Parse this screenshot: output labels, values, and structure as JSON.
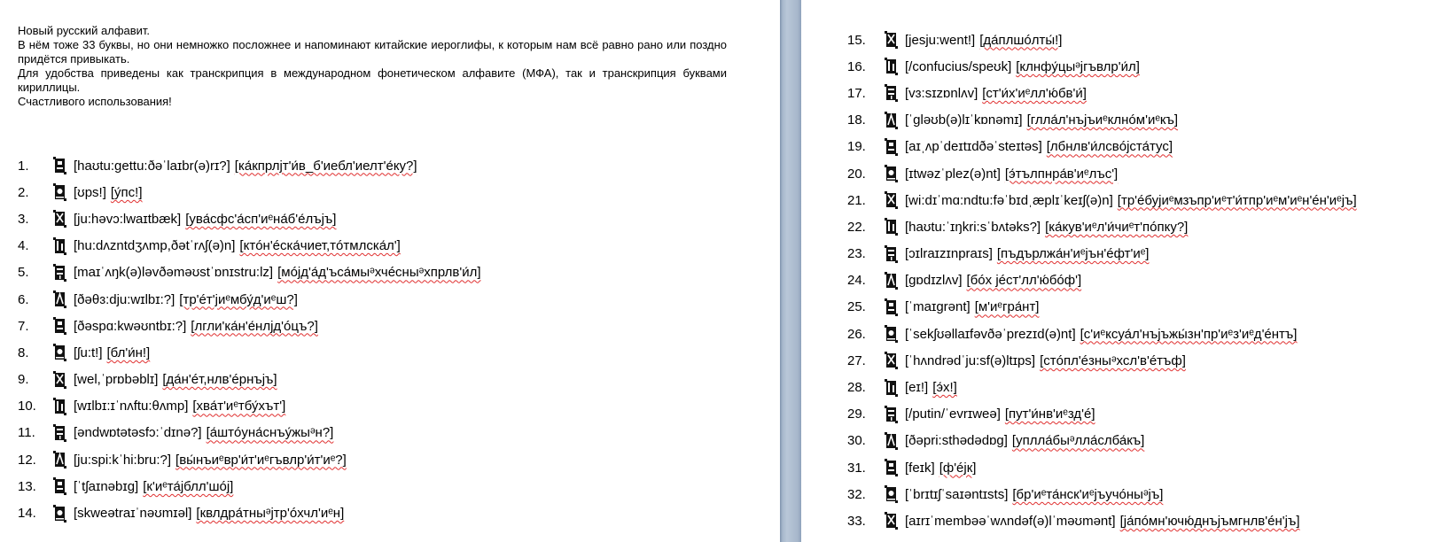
{
  "intro": {
    "title": "Новый русский алфавит.",
    "line1": "В нём тоже 33 буквы, но они немножко посложнее и напоминают китайские иероглифы, к которым нам всё равно рано или поздно придётся привыкать.",
    "line2": "Для удобства приведены как транскрипция в международном фонетическом алфавите (МФА), так и транскрипция буквами кириллицы.",
    "line3": "Счастливого использования!"
  },
  "letters": [
    {
      "n": "1.",
      "ipa": "[haʊtu:gettu:ðəˈlaɪbr(ə)rɪ?]",
      "cyr": "[ка́кпрлjт'и́в_б'иебл'иелт'е́ку?]"
    },
    {
      "n": "2.",
      "ipa": "[ʊps!]",
      "cyr": "[у́пс!]"
    },
    {
      "n": "3.",
      "ipa": "[ju:həvɔ:lwaɪtbæk]",
      "cyr": "[ува́сфс'а́сп'иᵉна́б'е́лъjъ]"
    },
    {
      "n": "4.",
      "ipa": "[hu:dʌzntdʒʌmp,ðətˈrʌʃ(ə)n]",
      "cyr": "[ктóн'éска́чиет,тóтмлска́л']"
    },
    {
      "n": "5.",
      "ipa": "[maɪˈʌŋk(ə)ləvðəməʊstˈɒnɪstru:lz]",
      "cyr": "[мójд'а́д'ъса́мыᵊхчéсныᵊхпрлв'и́л]"
    },
    {
      "n": "6.",
      "ipa": "[ðəθɜ:dju:wɪlbɪ:?]",
      "cyr": "[тр'éт'jиᵉмбу́д'иᵉш?]"
    },
    {
      "n": "7.",
      "ipa": "[ðəspɑ:kwəʊntbɪ:?]",
      "cyr": "[лгли'ка́н'е́нлjд'óцъ?]"
    },
    {
      "n": "8.",
      "ipa": "[ʃu:t!]",
      "cyr": "[бл'и́н!]"
    },
    {
      "n": "9.",
      "ipa": "[wel,ˈprɒbəblɪ]",
      "cyr": "[да́н'éт,нлв'éрнъjъ]"
    },
    {
      "n": "10.",
      "ipa": "[wɪlbɪ:ɪˈnʌftu:θʌmp]",
      "cyr": "[хва́т'иᵉтбу́хът']"
    },
    {
      "n": "11.",
      "ipa": "[əndwɒtətəsfɔ:ˈdɪnə?]",
      "cyr": "[а́штóуна́снъу́жыᵊн?]"
    },
    {
      "n": "12.",
      "ipa": "[ju:spi:kˈhi:bru:?]",
      "cyr": "[вы́нъиᵉвр'и́т'иᵉгъвлр'и́т'иᵉ?]"
    },
    {
      "n": "13.",
      "ipa": "[ˈtʃaɪnəbɪg]",
      "cyr": "[к'иᵉта́jблл'шój]"
    },
    {
      "n": "14.",
      "ipa": "[skweətraɪˈnəʊmɪəl]",
      "cyr": "[квлдра́тныᵊjтр'óхчл'иᵉн]"
    },
    {
      "n": "15.",
      "ipa": "[jesju:went!]",
      "cyr": "[да́плшóлты́!]"
    },
    {
      "n": "16.",
      "ipa": "[/confucius/speʊk]",
      "cyr": "[клнфу́цыᵊjгъвлр'и́л]"
    },
    {
      "n": "17.",
      "ipa": "[vɜ:sɪzɒnlʌv]",
      "cyr": "[ст'и́х'иᵉлл'ю́бв'и́]"
    },
    {
      "n": "18.",
      "ipa": "[ˈgləʊb(ə)lɪˈkɒnəmɪ]",
      "cyr": "[глла́л'нъjъиᵉклнóм'иᵉкъ]"
    },
    {
      "n": "19.",
      "ipa": "[aɪˌʌpˈdeɪtɪdðəˈsteɪtəs]",
      "cyr": "[лбнлв'и́лсвójста́тус]"
    },
    {
      "n": "20.",
      "ipa": "[ɪtwəzˈplez(ə)nt]",
      "cyr": "[э́тълпнра́в'иᵉлъс']"
    },
    {
      "n": "21.",
      "ipa": "[wi:dɪˈmɑ:ndtu:fəˈbɪdˌæplɪˈkeɪʃ(ə)n]",
      "cyr": "[тр'éбуjиᵉмзъпр'иᵉт'и́тпр'иᵉм'иᵉн'éн'иᵉjъ]"
    },
    {
      "n": "22.",
      "ipa": "[haʊtu:ˈɪŋkri:sˈbʌtəks?]",
      "cyr": "[ка́кув'иᵉл'и́чиᵉт'пóпку?]"
    },
    {
      "n": "23.",
      "ipa": "[ɔɪlraɪzɪnpraɪs]",
      "cyr": "[пъдърлжа́н'иᵉjън'éфт'иᵉ]"
    },
    {
      "n": "24.",
      "ipa": "[gɒdɪzlʌv]",
      "cyr": "[бóх jéст'лл'ю́бóф']"
    },
    {
      "n": "25.",
      "ipa": "[ˈmaɪgrənt]",
      "cyr": "[м'иᵉгра́нт]"
    },
    {
      "n": "26.",
      "ipa": "[ˈsekʃʊəllaɪfəvðəˈprezɪd(ə)nt]",
      "cyr": "[с'иᵉксуа́л'нъjъжы́зн'пр'иᵉз'иᵉд'éнтъ]"
    },
    {
      "n": "27.",
      "ipa": "[ˈhʌndrədˈju:sf(ə)ltɪps]",
      "cyr": "[стóпл'éзныᵊхсл'в'éтъф]"
    },
    {
      "n": "28.",
      "ipa": "[eɪ!]",
      "cyr": "[э́х!]"
    },
    {
      "n": "29.",
      "ipa": "[/putin/ˈevrɪweə]",
      "cyr": "[пут'и́нв'иᵉзд'é]"
    },
    {
      "n": "30.",
      "ipa": "[ðəpri:sthədədɒg]",
      "cyr": "[уплла́быᵊлла́слба́къ]"
    },
    {
      "n": "31.",
      "ipa": "[feɪk]",
      "cyr": "[ф'éjк]"
    },
    {
      "n": "32.",
      "ipa": "[ˈbrɪtɪʃˈsaɪəntɪsts]",
      "cyr": "[бр'иᵉта́нск'иᵉjъучóныᵊjъ]"
    },
    {
      "n": "33.",
      "ipa": "[aɪrɪˈmembəəˈwʌndəf(ə)lˈməʊmənt]",
      "cyr": "[jа́пóмн'ючю́днъjъмгнлв'éн'jъ]"
    }
  ]
}
